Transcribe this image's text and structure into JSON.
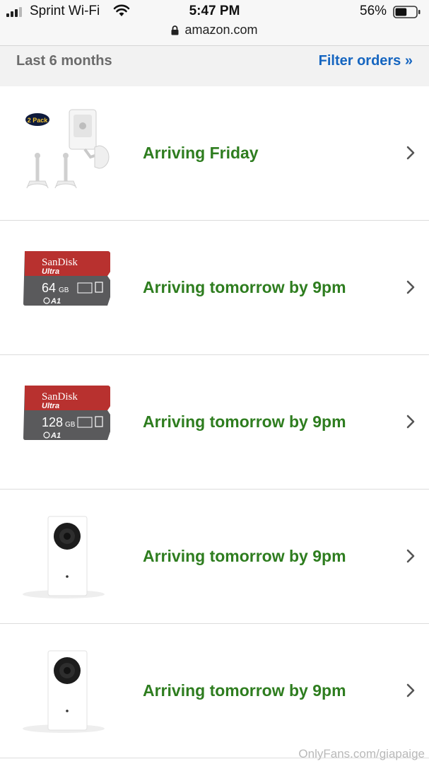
{
  "status_bar": {
    "carrier": "Sprint Wi-Fi",
    "time": "5:47 PM",
    "url": "amazon.com",
    "battery": "56%",
    "battery_level": 0.56
  },
  "filter_bar": {
    "range": "Last 6 months",
    "filter_link": "Filter orders »"
  },
  "orders": [
    {
      "status": "Arriving Friday",
      "product_image": "camera-mount-2-pack",
      "pack_badge": "2 Pack"
    },
    {
      "status": "Arriving tomorrow by 9pm",
      "product_image": "sandisk-microsd-64gb",
      "brand": "SanDisk",
      "line": "Ultra",
      "capacity": "64",
      "unit": "GB",
      "rating": "A1"
    },
    {
      "status": "Arriving tomorrow by 9pm",
      "product_image": "sandisk-microsd-128gb",
      "brand": "SanDisk",
      "line": "Ultra",
      "capacity": "128",
      "unit": "GB",
      "rating": "A1"
    },
    {
      "status": "Arriving tomorrow by 9pm",
      "product_image": "white-security-camera"
    },
    {
      "status": "Arriving tomorrow by 9pm",
      "product_image": "white-security-camera"
    }
  ],
  "watermark": "OnlyFans.com/giapaige",
  "colors": {
    "status_green": "#2e7d1f",
    "link_blue": "#1565c0",
    "card_red": "#b8312f",
    "card_gray": "#5a5a5c"
  }
}
